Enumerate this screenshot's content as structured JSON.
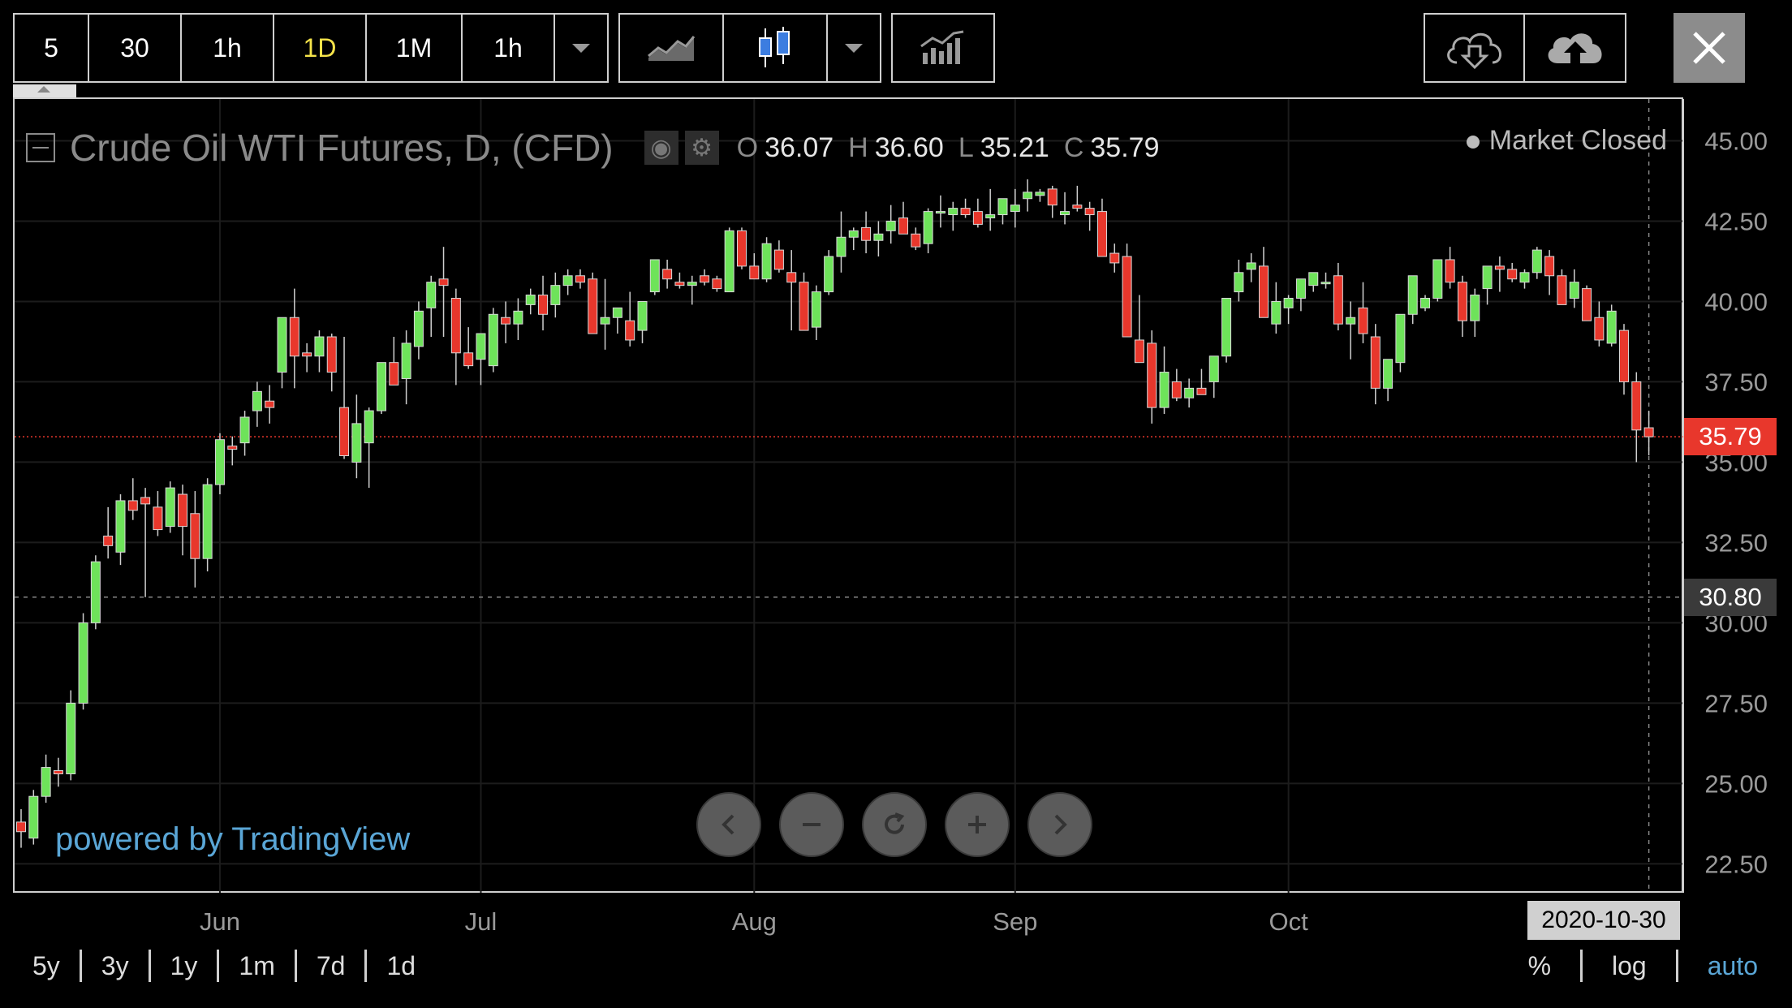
{
  "toolbar": {
    "intervals": [
      {
        "label": "5",
        "active": false
      },
      {
        "label": "30",
        "active": false
      },
      {
        "label": "1h",
        "active": false
      },
      {
        "label": "1D",
        "active": true
      },
      {
        "label": "1M",
        "active": false
      },
      {
        "label": "1h",
        "active": false
      }
    ],
    "chart_type_icons": [
      "line-chart-icon",
      "candlestick-icon"
    ],
    "indicator_icon": "indicators-icon",
    "cloud_icons": [
      "cloud-download-icon",
      "cloud-upload-icon"
    ],
    "close_icon": "close-icon"
  },
  "legend": {
    "title": "Crude Oil WTI Futures, D, (CFD)",
    "ohlc": [
      {
        "k": "O",
        "v": "36.07"
      },
      {
        "k": "H",
        "v": "36.60"
      },
      {
        "k": "L",
        "v": "35.21"
      },
      {
        "k": "C",
        "v": "35.79"
      }
    ]
  },
  "status": {
    "market": "Market Closed"
  },
  "watermark": "powered by TradingView",
  "bottom": {
    "ranges": [
      "5y",
      "3y",
      "1y",
      "1m",
      "7d",
      "1d"
    ],
    "options": [
      {
        "label": "%",
        "active": false
      },
      {
        "label": "log",
        "active": false
      },
      {
        "label": "auto",
        "active": true
      }
    ]
  },
  "crosshair": {
    "price_label": "30.80",
    "date_label": "2020-10-30",
    "price": 30.8
  },
  "last_price": {
    "label": "35.79",
    "value": 35.79
  },
  "colors": {
    "up": "#6ee35a",
    "down": "#e8372c",
    "last_price": "#e8372c",
    "axis_text": "#9a9a9a",
    "grid": "#1c1c1c"
  },
  "chart_data": {
    "type": "candlestick",
    "y_ticks": [
      22.5,
      25,
      27.5,
      30,
      32.5,
      35,
      37.5,
      40,
      42.5,
      45
    ],
    "y_tick_labels": [
      "22.50",
      "25.00",
      "27.50",
      "30.00",
      "32.50",
      "35.00",
      "37.50",
      "40.00",
      "42.50",
      "45.00"
    ],
    "x_ticks": [
      {
        "label": "Jun",
        "index": 16
      },
      {
        "label": "Jul",
        "index": 37
      },
      {
        "label": "Aug",
        "index": 59
      },
      {
        "label": "Sep",
        "index": 80
      },
      {
        "label": "Oct",
        "index": 102
      }
    ],
    "ylim": [
      21.6,
      46.3
    ],
    "candles": [
      [
        23.8,
        24.2,
        23.0,
        23.5
      ],
      [
        23.3,
        24.8,
        23.1,
        24.6
      ],
      [
        24.6,
        25.9,
        24.4,
        25.5
      ],
      [
        25.4,
        25.8,
        24.9,
        25.3
      ],
      [
        25.3,
        27.9,
        25.1,
        27.5
      ],
      [
        27.5,
        30.3,
        27.3,
        30.0
      ],
      [
        30.0,
        32.1,
        29.8,
        31.9
      ],
      [
        32.7,
        33.6,
        32.0,
        32.4
      ],
      [
        32.2,
        34.0,
        31.8,
        33.8
      ],
      [
        33.8,
        34.5,
        33.2,
        33.5
      ],
      [
        33.9,
        34.2,
        30.8,
        33.7
      ],
      [
        33.6,
        34.1,
        32.7,
        32.9
      ],
      [
        33.0,
        34.4,
        32.8,
        34.2
      ],
      [
        34.0,
        34.3,
        32.1,
        33.0
      ],
      [
        33.4,
        34.1,
        31.1,
        32.0
      ],
      [
        32.0,
        34.5,
        31.6,
        34.3
      ],
      [
        34.3,
        35.9,
        34.0,
        35.7
      ],
      [
        35.5,
        35.8,
        34.9,
        35.4
      ],
      [
        35.6,
        36.6,
        35.2,
        36.4
      ],
      [
        36.6,
        37.5,
        36.1,
        37.2
      ],
      [
        36.9,
        37.4,
        36.2,
        36.7
      ],
      [
        37.8,
        39.5,
        37.3,
        39.5
      ],
      [
        39.5,
        40.4,
        37.3,
        38.3
      ],
      [
        38.4,
        38.7,
        37.8,
        38.3
      ],
      [
        38.3,
        39.1,
        37.8,
        38.9
      ],
      [
        38.9,
        39.0,
        37.2,
        37.8
      ],
      [
        36.7,
        38.9,
        35.1,
        35.2
      ],
      [
        35.0,
        37.1,
        34.5,
        36.2
      ],
      [
        35.6,
        36.7,
        34.2,
        36.6
      ],
      [
        36.6,
        38.0,
        36.5,
        38.1
      ],
      [
        38.1,
        38.9,
        37.6,
        37.4
      ],
      [
        37.6,
        39.1,
        36.8,
        38.7
      ],
      [
        38.6,
        40.0,
        38.2,
        39.7
      ],
      [
        39.8,
        40.8,
        38.9,
        40.6
      ],
      [
        40.7,
        41.7,
        38.9,
        40.5
      ],
      [
        40.1,
        40.4,
        37.4,
        38.4
      ],
      [
        38.4,
        39.2,
        37.9,
        38.0
      ],
      [
        38.2,
        39.0,
        37.4,
        39.0
      ],
      [
        38.0,
        39.8,
        37.8,
        39.6
      ],
      [
        39.5,
        40.0,
        38.7,
        39.3
      ],
      [
        39.3,
        40.1,
        38.8,
        39.7
      ],
      [
        39.9,
        40.4,
        39.6,
        40.2
      ],
      [
        40.2,
        40.8,
        39.1,
        39.6
      ],
      [
        39.9,
        40.9,
        39.5,
        40.5
      ],
      [
        40.5,
        41.0,
        40.2,
        40.8
      ],
      [
        40.8,
        41.0,
        40.4,
        40.6
      ],
      [
        40.7,
        40.9,
        39.3,
        39.0
      ],
      [
        39.3,
        40.7,
        38.5,
        39.5
      ],
      [
        39.5,
        39.8,
        39.0,
        39.8
      ],
      [
        39.4,
        40.3,
        38.6,
        38.8
      ],
      [
        39.1,
        39.8,
        38.7,
        40.0
      ],
      [
        40.3,
        41.2,
        40.2,
        41.3
      ],
      [
        41.0,
        41.3,
        40.4,
        40.7
      ],
      [
        40.6,
        40.9,
        40.4,
        40.5
      ],
      [
        40.5,
        40.8,
        39.9,
        40.6
      ],
      [
        40.8,
        41.0,
        40.5,
        40.6
      ],
      [
        40.7,
        40.8,
        40.3,
        40.4
      ],
      [
        40.3,
        42.3,
        40.3,
        42.2
      ],
      [
        42.2,
        42.3,
        41.0,
        41.1
      ],
      [
        41.1,
        41.5,
        40.7,
        40.7
      ],
      [
        40.7,
        42.0,
        40.6,
        41.8
      ],
      [
        41.6,
        41.9,
        40.9,
        41.0
      ],
      [
        40.9,
        41.6,
        39.1,
        40.6
      ],
      [
        40.6,
        40.9,
        39.4,
        39.1
      ],
      [
        39.2,
        40.5,
        38.8,
        40.3
      ],
      [
        40.3,
        41.6,
        40.2,
        41.4
      ],
      [
        41.4,
        42.8,
        40.9,
        42.0
      ],
      [
        42.0,
        42.3,
        41.6,
        42.2
      ],
      [
        42.3,
        42.8,
        41.5,
        41.9
      ],
      [
        41.9,
        42.5,
        41.4,
        42.1
      ],
      [
        42.2,
        43.0,
        41.8,
        42.5
      ],
      [
        42.6,
        43.1,
        42.1,
        42.1
      ],
      [
        42.1,
        42.3,
        41.6,
        41.7
      ],
      [
        41.8,
        42.9,
        41.5,
        42.8
      ],
      [
        42.8,
        43.3,
        42.3,
        42.8
      ],
      [
        42.7,
        43.1,
        42.2,
        42.9
      ],
      [
        42.9,
        43.2,
        42.6,
        42.7
      ],
      [
        42.8,
        43.2,
        42.3,
        42.4
      ],
      [
        42.6,
        43.5,
        42.2,
        42.7
      ],
      [
        42.7,
        43.2,
        42.4,
        43.2
      ],
      [
        42.8,
        43.5,
        42.3,
        43.0
      ],
      [
        43.2,
        43.8,
        42.8,
        43.4
      ],
      [
        43.3,
        43.5,
        43.1,
        43.4
      ],
      [
        43.5,
        43.6,
        42.6,
        43.0
      ],
      [
        42.7,
        43.4,
        42.4,
        42.8
      ],
      [
        43.0,
        43.6,
        42.8,
        42.9
      ],
      [
        42.9,
        43.1,
        42.2,
        42.7
      ],
      [
        42.8,
        43.2,
        41.9,
        41.4
      ],
      [
        41.5,
        41.8,
        40.9,
        41.2
      ],
      [
        41.4,
        41.8,
        40.4,
        38.9
      ],
      [
        38.8,
        40.2,
        38.6,
        38.1
      ],
      [
        38.7,
        39.1,
        36.2,
        36.7
      ],
      [
        36.7,
        38.6,
        36.5,
        37.8
      ],
      [
        37.5,
        37.9,
        36.9,
        37.0
      ],
      [
        37.0,
        37.6,
        36.7,
        37.3
      ],
      [
        37.3,
        37.9,
        37.1,
        37.1
      ],
      [
        37.5,
        38.0,
        37.0,
        38.3
      ],
      [
        38.3,
        39.5,
        38.1,
        40.1
      ],
      [
        40.3,
        41.3,
        40.0,
        40.9
      ],
      [
        41.0,
        41.5,
        40.6,
        41.2
      ],
      [
        41.1,
        41.7,
        40.3,
        39.5
      ],
      [
        39.3,
        40.6,
        39.0,
        40.0
      ],
      [
        39.8,
        40.2,
        39.3,
        40.1
      ],
      [
        40.1,
        40.7,
        39.7,
        40.7
      ],
      [
        40.5,
        40.9,
        40.3,
        40.9
      ],
      [
        40.6,
        40.9,
        40.4,
        40.6
      ],
      [
        40.8,
        41.2,
        39.1,
        39.3
      ],
      [
        39.3,
        40.0,
        38.2,
        39.5
      ],
      [
        39.8,
        40.6,
        38.7,
        39.0
      ],
      [
        38.9,
        39.3,
        36.8,
        37.3
      ],
      [
        37.3,
        37.9,
        36.9,
        38.2
      ],
      [
        38.1,
        39.6,
        37.8,
        39.6
      ],
      [
        39.6,
        40.7,
        39.3,
        40.8
      ],
      [
        39.8,
        40.2,
        39.7,
        40.1
      ],
      [
        40.1,
        41.1,
        40.0,
        41.3
      ],
      [
        41.3,
        41.7,
        40.4,
        40.6
      ],
      [
        40.6,
        40.8,
        38.9,
        39.4
      ],
      [
        39.4,
        40.4,
        38.9,
        40.2
      ],
      [
        40.4,
        40.9,
        39.9,
        41.1
      ],
      [
        41.1,
        41.4,
        40.3,
        41.0
      ],
      [
        41.0,
        41.2,
        40.6,
        40.7
      ],
      [
        40.6,
        41.0,
        40.4,
        40.9
      ],
      [
        40.9,
        41.7,
        40.7,
        41.6
      ],
      [
        41.4,
        41.6,
        40.2,
        40.8
      ],
      [
        40.8,
        41.0,
        39.9,
        39.9
      ],
      [
        40.1,
        41.0,
        39.8,
        40.6
      ],
      [
        40.4,
        40.5,
        39.6,
        39.4
      ],
      [
        39.5,
        40.0,
        38.6,
        38.8
      ],
      [
        38.7,
        39.9,
        38.6,
        39.7
      ],
      [
        39.1,
        39.3,
        37.1,
        37.5
      ],
      [
        37.5,
        37.8,
        35.0,
        36.0
      ],
      [
        36.07,
        36.6,
        35.21,
        35.79
      ]
    ]
  }
}
